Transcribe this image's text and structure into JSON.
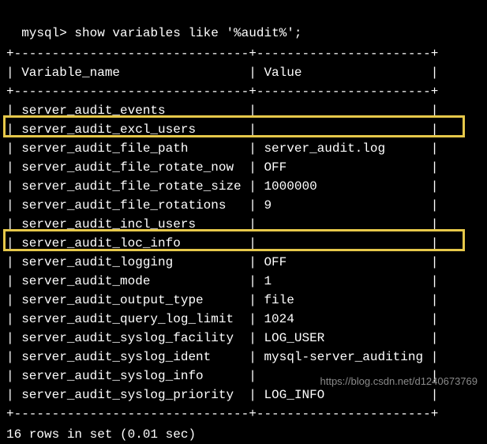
{
  "prompt": "mysql>",
  "query": "show variables like '%audit%';",
  "headers": {
    "col1": "Variable_name",
    "col2": "Value"
  },
  "rows": [
    {
      "name": "server_audit_events",
      "value": ""
    },
    {
      "name": "server_audit_excl_users",
      "value": ""
    },
    {
      "name": "server_audit_file_path",
      "value": "server_audit.log"
    },
    {
      "name": "server_audit_file_rotate_now",
      "value": "OFF"
    },
    {
      "name": "server_audit_file_rotate_size",
      "value": "1000000"
    },
    {
      "name": "server_audit_file_rotations",
      "value": "9"
    },
    {
      "name": "server_audit_incl_users",
      "value": ""
    },
    {
      "name": "server_audit_loc_info",
      "value": ""
    },
    {
      "name": "server_audit_logging",
      "value": "OFF"
    },
    {
      "name": "server_audit_mode",
      "value": "1"
    },
    {
      "name": "server_audit_output_type",
      "value": "file"
    },
    {
      "name": "server_audit_query_log_limit",
      "value": "1024"
    },
    {
      "name": "server_audit_syslog_facility",
      "value": "LOG_USER"
    },
    {
      "name": "server_audit_syslog_ident",
      "value": "mysql-server_auditing"
    },
    {
      "name": "server_audit_syslog_info",
      "value": ""
    },
    {
      "name": "server_audit_syslog_priority",
      "value": "LOG_INFO"
    }
  ],
  "footer": "16 rows in set (0.01 sec)",
  "watermark": "https://blog.csdn.net/d1240673769",
  "border_top": "+-------------------------------+-----------------------+",
  "col1_width": 31,
  "col2_width": 23
}
